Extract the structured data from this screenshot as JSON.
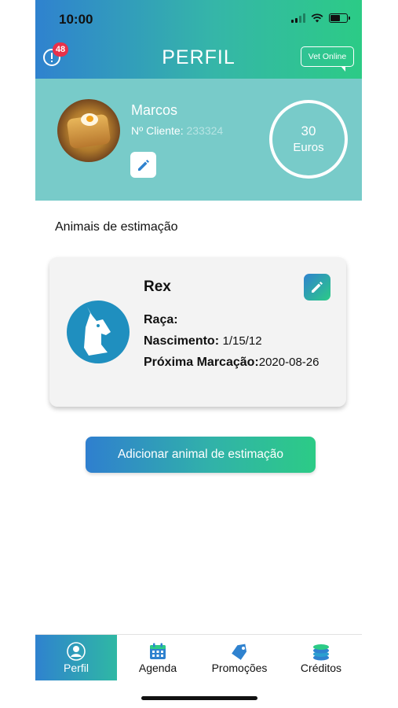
{
  "status_bar": {
    "time": "10:00"
  },
  "header": {
    "title": "PERFIL",
    "alert_count": "48",
    "vet_online_label": "Vet Online",
    "gradient_start": "#2f82cf",
    "gradient_end": "#2ccb86"
  },
  "profile": {
    "name": "Marcos",
    "client_label": "Nº Cliente:",
    "client_number": "233324",
    "credit_amount": "30",
    "credit_unit": "Euros",
    "band_color": "#78cbc9"
  },
  "pets_section": {
    "title": "Animais de estimação",
    "pets": [
      {
        "name": "Rex",
        "breed_label": "Raça:",
        "breed_value": "",
        "birth_label": "Nascimento:",
        "birth_value": "1/15/12",
        "next_label": "Próxima Marcação:",
        "next_value": "2020-08-26"
      }
    ],
    "add_button_label": "Adicionar animal de estimação"
  },
  "tabbar": {
    "tabs": [
      {
        "label": "Perfil",
        "icon": "user-icon",
        "active": true
      },
      {
        "label": "Agenda",
        "icon": "calendar-icon",
        "active": false
      },
      {
        "label": "Promoções",
        "icon": "tag-icon",
        "active": false
      },
      {
        "label": "Créditos",
        "icon": "coins-icon",
        "active": false
      }
    ]
  }
}
